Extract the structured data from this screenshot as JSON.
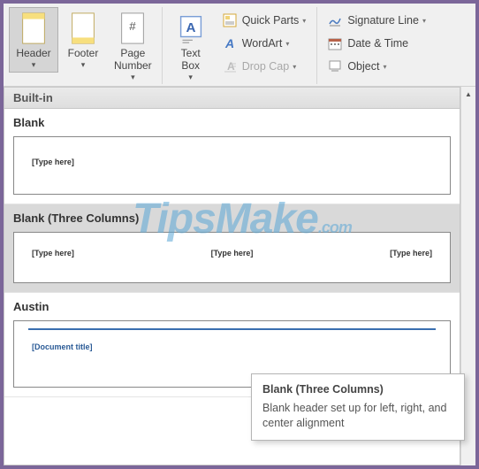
{
  "ribbon": {
    "header": "Header",
    "footer": "Footer",
    "page_number": "Page\nNumber",
    "text_box": "Text\nBox",
    "quick_parts": "Quick Parts",
    "wordart": "WordArt",
    "drop_cap": "Drop Cap",
    "signature_line": "Signature Line",
    "date_time": "Date & Time",
    "object": "Object"
  },
  "gallery": {
    "section": "Built-in",
    "items": [
      {
        "title": "Blank",
        "placeholders": [
          "[Type here]"
        ]
      },
      {
        "title": "Blank (Three Columns)",
        "placeholders": [
          "[Type here]",
          "[Type here]",
          "[Type here]"
        ]
      },
      {
        "title": "Austin",
        "placeholders": [
          "[Document title]"
        ]
      }
    ]
  },
  "tooltip": {
    "title": "Blank (Three Columns)",
    "body": "Blank header set up for left, right, and center alignment"
  },
  "watermark": "TipsMake",
  "watermark_suffix": ".com"
}
